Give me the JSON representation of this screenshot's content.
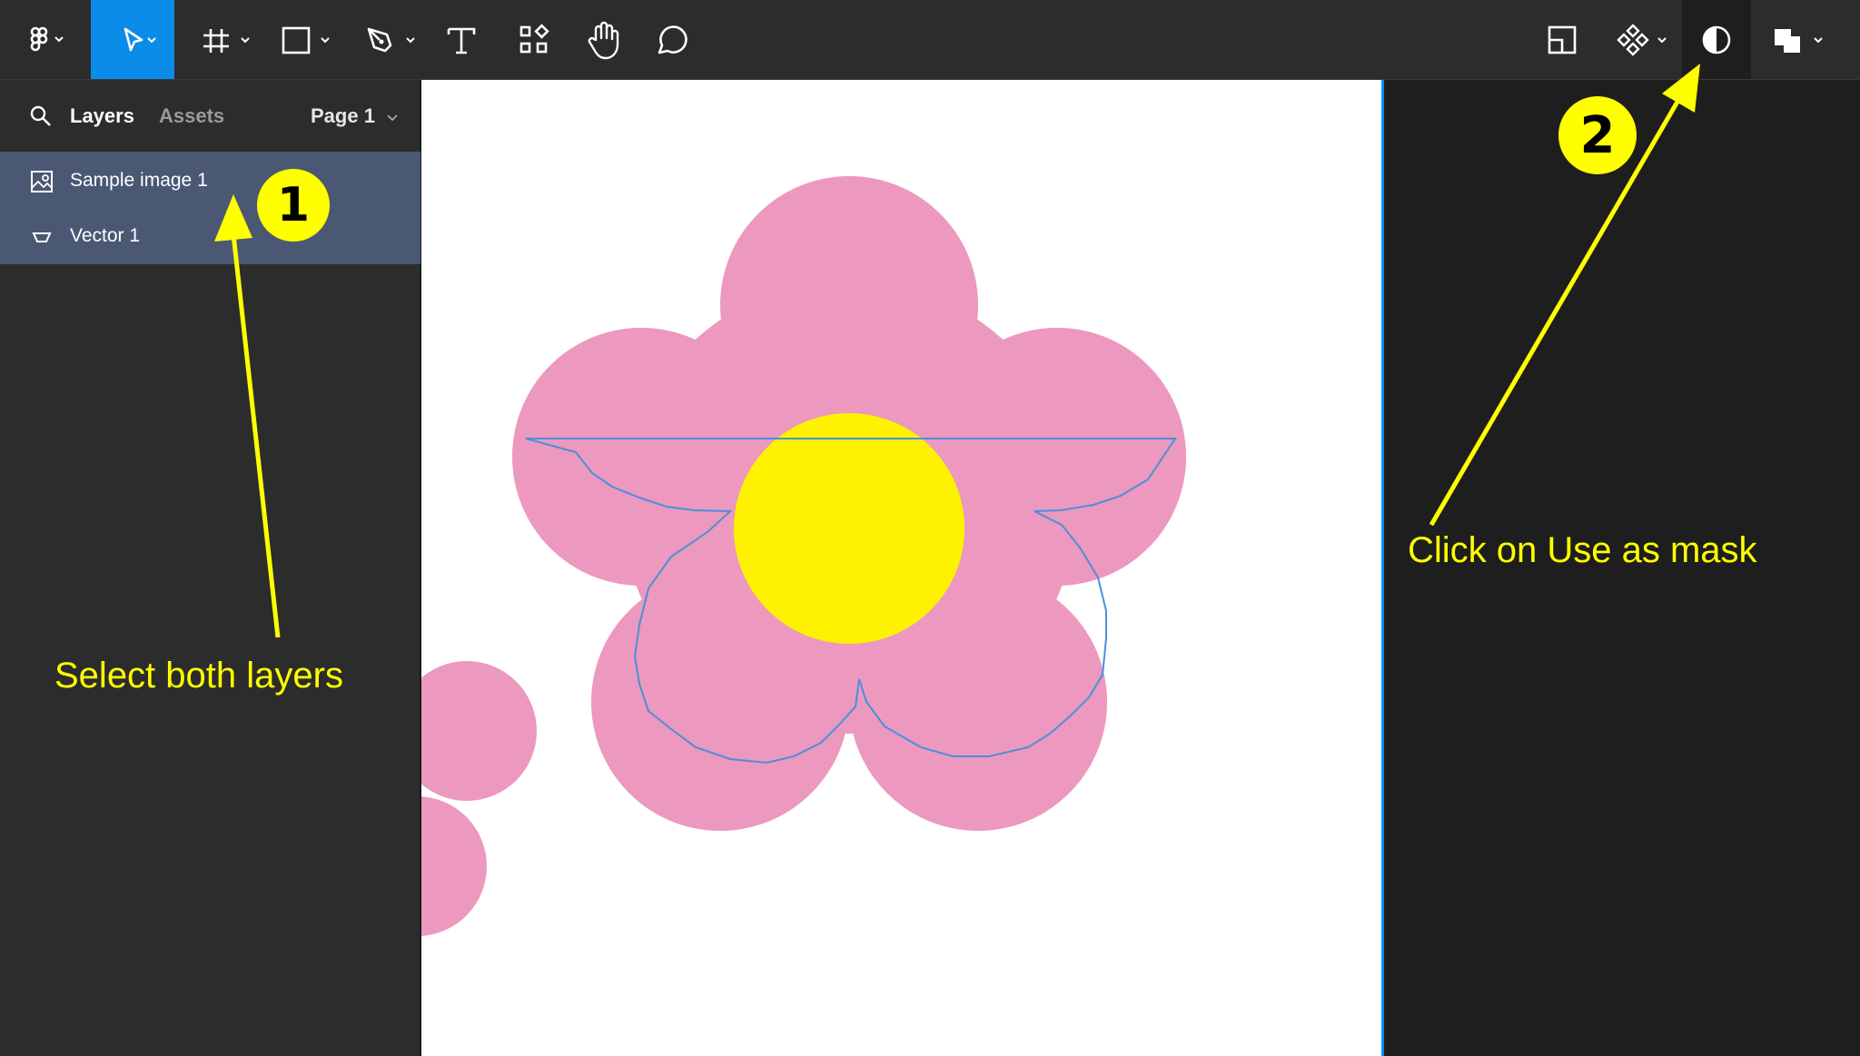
{
  "toolbar": {
    "tools": [
      {
        "name": "figma-menu",
        "icon": "figma-logo-icon"
      },
      {
        "name": "move-tool",
        "icon": "cursor-arrow-icon",
        "active": true
      },
      {
        "name": "frame-tool",
        "icon": "hash-frame-icon"
      },
      {
        "name": "shape-tool",
        "icon": "rectangle-icon"
      },
      {
        "name": "pen-tool",
        "icon": "pen-nib-icon"
      },
      {
        "name": "text-tool",
        "icon": "text-t-icon"
      },
      {
        "name": "resources-tool",
        "icon": "components-grid-icon"
      },
      {
        "name": "hand-tool",
        "icon": "hand-icon"
      },
      {
        "name": "comment-tool",
        "icon": "speech-bubble-icon"
      }
    ],
    "right_tools": [
      {
        "name": "crop-frame",
        "icon": "crop-frame-icon"
      },
      {
        "name": "create-component",
        "icon": "component-diamond-icon"
      },
      {
        "name": "use-as-mask",
        "icon": "mask-half-circle-icon",
        "highlighted": true
      },
      {
        "name": "boolean-ops",
        "icon": "boolean-union-icon"
      }
    ]
  },
  "left_panel": {
    "tabs": {
      "layers": "Layers",
      "assets": "Assets"
    },
    "page_label": "Page 1",
    "layers": [
      {
        "label": "Sample image 1",
        "icon": "image-icon"
      },
      {
        "label": "Vector 1",
        "icon": "vector-icon"
      }
    ]
  },
  "colors": {
    "petal": "#ec98bf",
    "center": "#fff200",
    "selection": "#4a90d9",
    "accent": "#0c8ce9",
    "annotation": "#ffff00"
  },
  "annotations": {
    "step1_badge": "1",
    "step1_text": "Select both layers",
    "step2_badge": "2",
    "step2_text": "Click on Use as mask"
  }
}
